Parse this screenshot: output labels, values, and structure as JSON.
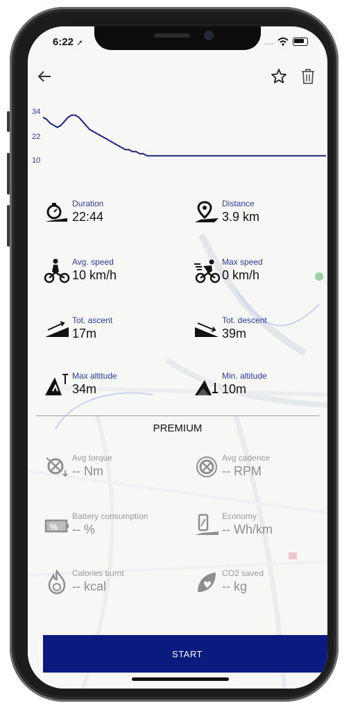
{
  "status_bar": {
    "time": "6:22",
    "signal": "....."
  },
  "toolbar": {
    "back_icon": "arrow-left",
    "favorite_icon": "star-outline",
    "delete_icon": "trash"
  },
  "speed_chart": {
    "y_ticks": [
      "34",
      "22",
      "10"
    ],
    "line_color": "#1a237e"
  },
  "chart_data": {
    "type": "line",
    "ylim": [
      10,
      34
    ],
    "y_ticks": [
      34,
      22,
      10
    ],
    "series": [
      {
        "values": [
          31,
          30,
          28,
          27,
          26,
          27,
          29,
          31,
          32,
          32,
          31,
          29,
          27,
          25,
          24,
          23,
          22,
          21,
          20,
          19,
          18,
          17,
          16,
          15,
          15,
          14,
          14,
          13,
          13,
          12,
          12,
          12,
          12,
          12,
          12,
          12,
          12,
          12,
          12,
          12,
          12,
          12,
          12,
          12,
          12,
          12,
          12,
          12,
          12,
          12,
          12,
          12,
          12,
          12,
          12,
          12,
          12,
          12,
          12,
          12,
          12,
          12,
          12,
          12,
          12,
          12,
          12,
          12,
          12,
          12,
          12,
          12,
          12,
          12,
          12,
          12,
          12,
          12,
          12,
          12
        ]
      }
    ]
  },
  "stats": {
    "duration": {
      "label": "Duration",
      "value": "22:44"
    },
    "distance": {
      "label": "Distance",
      "value": "3.9 km"
    },
    "avg_speed": {
      "label": "Avg. speed",
      "value": "10 km/h"
    },
    "max_speed": {
      "label": "Max speed",
      "value": "0 km/h"
    },
    "tot_ascent": {
      "label": "Tot. ascent",
      "value": "17m"
    },
    "tot_descent": {
      "label": "Tot. descent",
      "value": "39m"
    },
    "max_altitude": {
      "label": "Max altitude",
      "value": "34m"
    },
    "min_altitude": {
      "label": "Min. altitude",
      "value": "10m"
    }
  },
  "premium": {
    "title": "PREMIUM",
    "avg_torque": {
      "label": "Avg torque",
      "value": "-- Nm"
    },
    "avg_cadence": {
      "label": "Avg cadence",
      "value": "-- RPM"
    },
    "battery": {
      "label": "Battery consumption",
      "value": "-- %"
    },
    "economy": {
      "label": "Economy",
      "value": "-- Wh/km"
    },
    "calories": {
      "label": "Calories burnt",
      "value": "-- kcal"
    },
    "co2": {
      "label": "CO2 saved",
      "value": "-- kg"
    }
  },
  "start_button": {
    "label": "START",
    "color": "#0a1a7f"
  }
}
